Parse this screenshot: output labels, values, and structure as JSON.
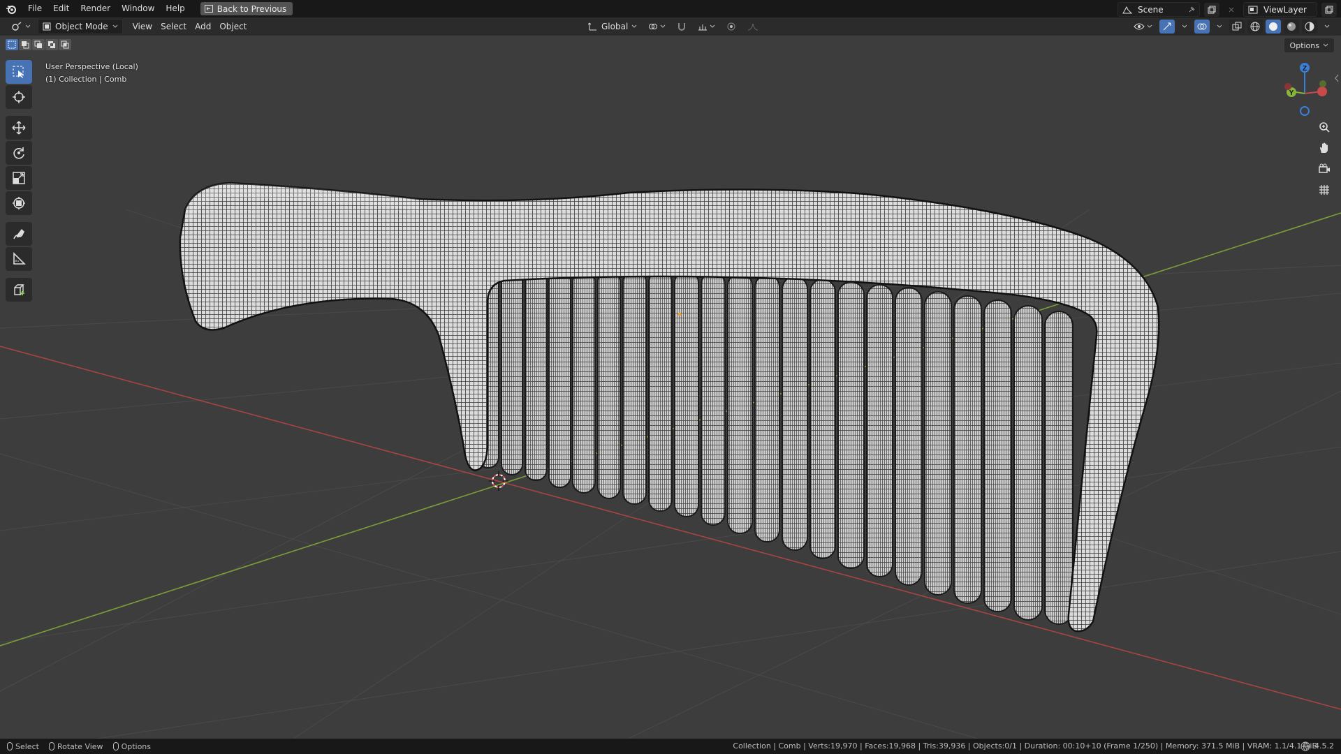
{
  "topbar": {
    "menus": [
      "File",
      "Edit",
      "Render",
      "Window",
      "Help"
    ],
    "back_button": "Back to Previous",
    "scene": "Scene",
    "view_layer": "ViewLayer"
  },
  "header": {
    "mode": "Object Mode",
    "menus": [
      "View",
      "Select",
      "Add",
      "Object"
    ],
    "orientation": "Global",
    "options": "Options"
  },
  "viewport": {
    "perspective": "User Perspective (Local)",
    "collection_line": "(1) Collection | Comb",
    "colors": {
      "x_axis": "#c84a4a",
      "y_axis": "#86b43c",
      "z_axis": "#3b7fd6",
      "accent": "#4772b3"
    }
  },
  "statusbar": {
    "select": "Select",
    "rotate": "Rotate View",
    "options": "Options",
    "stats": "Collection | Comb | Verts:19,970 | Faces:19,968 | Tris:39,936 | Objects:0/1 | Duration: 00:10+10 (Frame 1/250) | Memory: 371.5 MiB | VRAM: 1.1/4.1 GiB",
    "version": "4.5.2"
  },
  "icons": {
    "toolbar": [
      "select-box-icon",
      "cursor-icon",
      "move-icon",
      "rotate-icon",
      "scale-icon",
      "transform-icon",
      "annotate-icon",
      "measure-icon",
      "add-cube-icon"
    ],
    "nav": [
      "zoom-icon",
      "pan-hand-icon",
      "camera-icon",
      "grid-ortho-icon"
    ]
  }
}
